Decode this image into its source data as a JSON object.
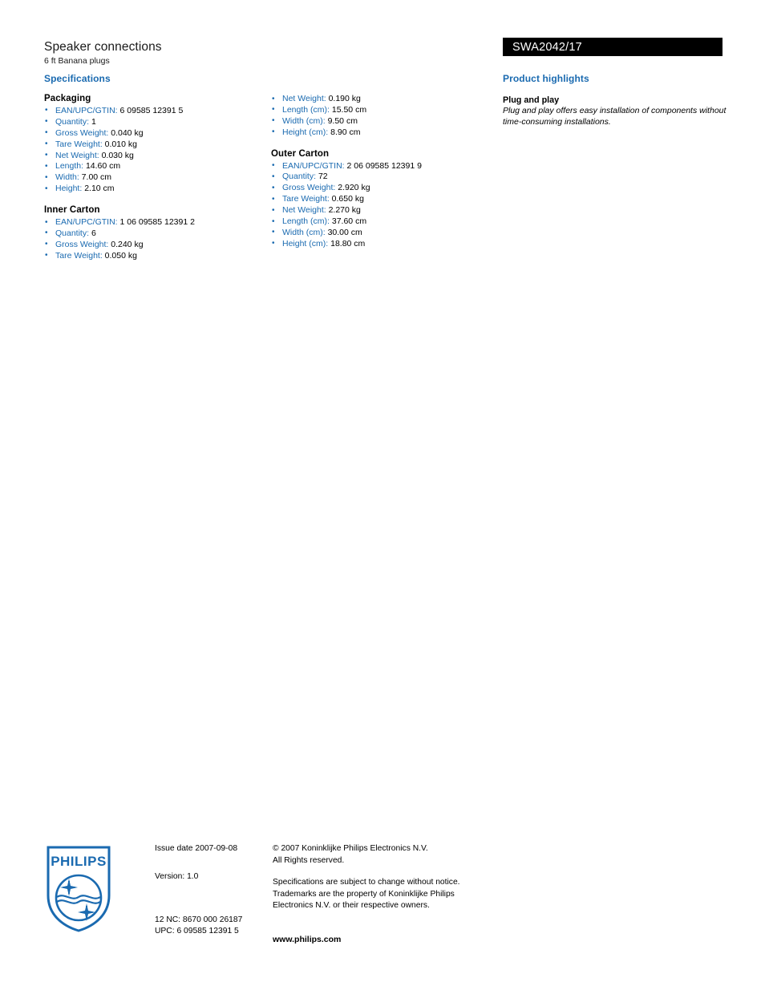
{
  "document": {
    "product_title": "Speaker connections",
    "product_subtitle": "6 ft Banana plugs",
    "model_number": "SWA2042/17"
  },
  "colors": {
    "accent_blue": "#1a6ab0",
    "bar_background": "#000000",
    "bar_text": "#ffffff",
    "body_text": "#000000"
  },
  "specifications": {
    "heading": "Specifications",
    "left_column": [
      {
        "title": "Packaging",
        "items": [
          {
            "label": "EAN/UPC/GTIN:",
            "value": "6 09585 12391 5"
          },
          {
            "label": "Quantity:",
            "value": "1"
          },
          {
            "label": "Gross Weight:",
            "value": "0.040 kg"
          },
          {
            "label": "Tare Weight:",
            "value": "0.010 kg"
          },
          {
            "label": "Net Weight:",
            "value": "0.030 kg"
          },
          {
            "label": "Length:",
            "value": "14.60 cm"
          },
          {
            "label": "Width:",
            "value": "7.00 cm"
          },
          {
            "label": "Height:",
            "value": "2.10 cm"
          }
        ]
      },
      {
        "title": "Inner Carton",
        "items": [
          {
            "label": "EAN/UPC/GTIN:",
            "value": "1 06 09585 12391 2"
          },
          {
            "label": "Quantity:",
            "value": "6"
          },
          {
            "label": "Gross Weight:",
            "value": "0.240 kg"
          },
          {
            "label": "Tare Weight:",
            "value": "0.050 kg"
          }
        ]
      }
    ],
    "middle_column": [
      {
        "title": "",
        "items": [
          {
            "label": "Net Weight:",
            "value": "0.190 kg"
          },
          {
            "label": "Length (cm):",
            "value": "15.50 cm"
          },
          {
            "label": "Width (cm):",
            "value": "9.50 cm"
          },
          {
            "label": "Height (cm):",
            "value": "8.90 cm"
          }
        ]
      },
      {
        "title": "Outer Carton",
        "items": [
          {
            "label": "EAN/UPC/GTIN:",
            "value": "2 06 09585 12391 9"
          },
          {
            "label": "Quantity:",
            "value": "72"
          },
          {
            "label": "Gross Weight:",
            "value": "2.920 kg"
          },
          {
            "label": "Tare Weight:",
            "value": "0.650 kg"
          },
          {
            "label": "Net Weight:",
            "value": "2.270 kg"
          },
          {
            "label": "Length (cm):",
            "value": "37.60 cm"
          },
          {
            "label": "Width (cm):",
            "value": "30.00 cm"
          },
          {
            "label": "Height (cm):",
            "value": "18.80 cm"
          }
        ]
      }
    ],
    "bullet_glyph": "•"
  },
  "highlights": {
    "heading": "Product highlights",
    "items": [
      {
        "title": "Plug and play",
        "description": "Plug and play offers easy installation of components without time-consuming installations."
      }
    ]
  },
  "footer": {
    "logo_wordmark": "PHILIPS",
    "issue_date": "Issue date 2007-09-08",
    "version": "Version: 1.0",
    "nc_code": "12 NC: 8670 000 26187",
    "upc_code": "UPC: 6 09585 12391 5",
    "copyright_line_1": "© 2007 Koninklijke Philips Electronics N.V.",
    "copyright_line_2": "All Rights reserved.",
    "disclaimer_line_1": "Specifications are subject to change without notice.",
    "disclaimer_line_2": "Trademarks are the property of Koninklijke Philips",
    "disclaimer_line_3": "Electronics N.V. or their respective owners.",
    "website": "www.philips.com"
  }
}
